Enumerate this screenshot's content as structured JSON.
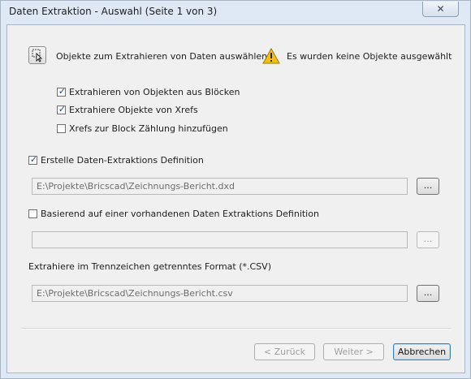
{
  "window": {
    "title": "Daten Extraktion - Auswahl (Seite 1 von 3)",
    "close_glyph": "✕"
  },
  "select_objects": {
    "label": "Objekte zum Extrahieren von Daten auswählen:"
  },
  "warning": {
    "text": "Es wurden keine Objekte ausgewählt"
  },
  "options": [
    {
      "label": "Extrahieren von Objekten aus Blöcken",
      "checked": true
    },
    {
      "label": "Extrahiere Objekte von Xrefs",
      "checked": true
    },
    {
      "label": "Xrefs zur Block Zählung hinzufügen",
      "checked": false
    }
  ],
  "create_definition": {
    "label": "Erstelle Daten-Extraktions Definition",
    "checked": true,
    "path": "E:\\Projekte\\Bricscad\\Zeichnungs-Bericht.dxd"
  },
  "existing_definition": {
    "label": "Basierend auf einer vorhandenen Daten Extraktions Definition",
    "checked": false,
    "path": ""
  },
  "csv": {
    "label": "Extrahiere im Trennzeichen getrenntes Format (*.CSV)",
    "path": "E:\\Projekte\\Bricscad\\Zeichnungs-Bericht.csv"
  },
  "browse_label": "...",
  "buttons": {
    "back": "< Zurück",
    "next": "Weiter >",
    "cancel": "Abbrechen"
  },
  "colors": {
    "frame": "#dfe9f5",
    "client": "#f0f0f0",
    "check": "#2e4a82",
    "warning": "#f2c014"
  }
}
